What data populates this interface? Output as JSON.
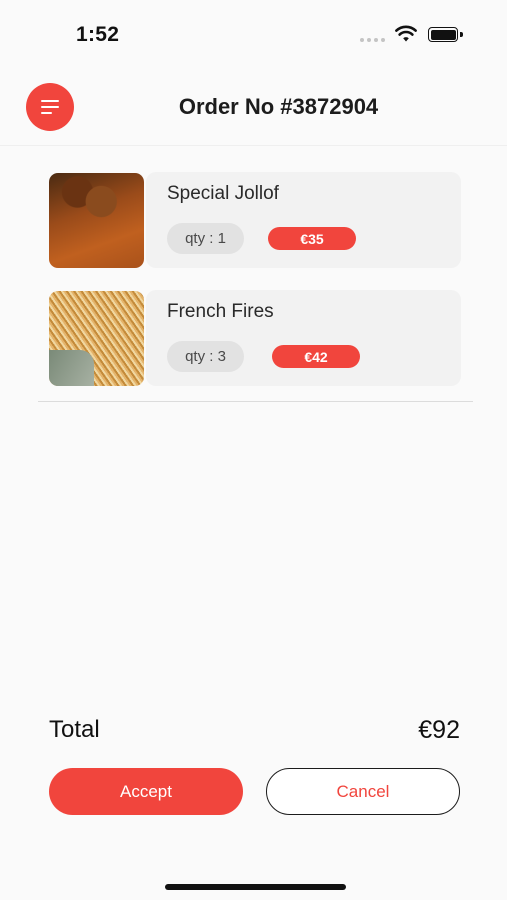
{
  "status_bar": {
    "time": "1:52"
  },
  "header": {
    "title": "Order No #3872904",
    "menu_icon": "menu-icon"
  },
  "items": [
    {
      "name": "Special Jollof",
      "qty": "qty : 1",
      "price": "€35"
    },
    {
      "name": "French Fires",
      "qty": "qty : 3",
      "price": "€42"
    }
  ],
  "summary": {
    "total_label": "Total",
    "total_value": "€92"
  },
  "actions": {
    "accept_label": "Accept",
    "cancel_label": "Cancel"
  },
  "colors": {
    "accent": "#f1453d",
    "background": "#fafafa",
    "card": "#f2f2f2"
  }
}
